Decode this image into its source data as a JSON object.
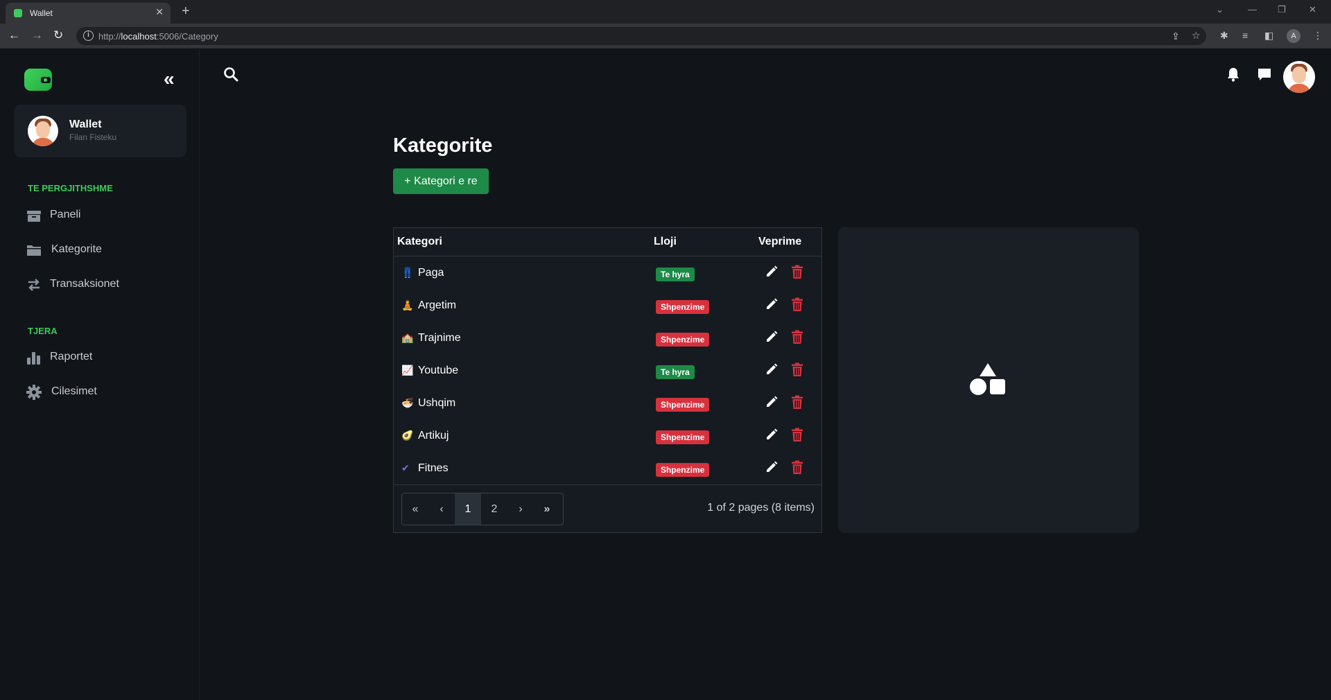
{
  "browser": {
    "tab_title": "Wallet",
    "url_prefix": "http://",
    "url_host": "localhost",
    "url_rest": ":5006/Category",
    "profile_initial": "A"
  },
  "sidebar": {
    "user_name": "Wallet",
    "user_sub": "Filan Fisteku",
    "section1": "TE PERGJITHSHME",
    "section2": "TJERA",
    "items": [
      {
        "label": "Paneli",
        "icon": "box-icon"
      },
      {
        "label": "Kategorite",
        "icon": "folder-icon"
      },
      {
        "label": "Transaksionet",
        "icon": "exchange-icon"
      },
      {
        "label": "Raportet",
        "icon": "chart-icon"
      },
      {
        "label": "Cilesimet",
        "icon": "gear-icon"
      }
    ]
  },
  "main": {
    "title": "Kategorite",
    "add_button": "+ Kategori e re",
    "table": {
      "headers": [
        "Kategori",
        "Lloji",
        "Veprime"
      ],
      "rows": [
        {
          "emoji": "👖",
          "name": "Paga",
          "type": "Te hyra"
        },
        {
          "emoji": "🧘",
          "name": "Argetim",
          "type": "Shpenzime"
        },
        {
          "emoji": "🏫",
          "name": "Trajnime",
          "type": "Shpenzime"
        },
        {
          "emoji": "📈",
          "name": "Youtube",
          "type": "Te hyra"
        },
        {
          "emoji": "🍜",
          "name": "Ushqim",
          "type": "Shpenzime"
        },
        {
          "emoji": "🥑",
          "name": "Artikuj",
          "type": "Shpenzime"
        },
        {
          "emoji": "✔",
          "name": "Fitnes",
          "type": "Shpenzime"
        }
      ]
    },
    "pager": {
      "first": "«",
      "prev": "‹",
      "pages": [
        "1",
        "2"
      ],
      "current": "1",
      "next": "›",
      "last": "»",
      "info": "1 of 2 pages (8 items)"
    }
  },
  "colors": {
    "accent_green": "#3ecb59",
    "income_badge": "#1e8a48",
    "expense_badge": "#d7313e",
    "background": "#11151a"
  }
}
